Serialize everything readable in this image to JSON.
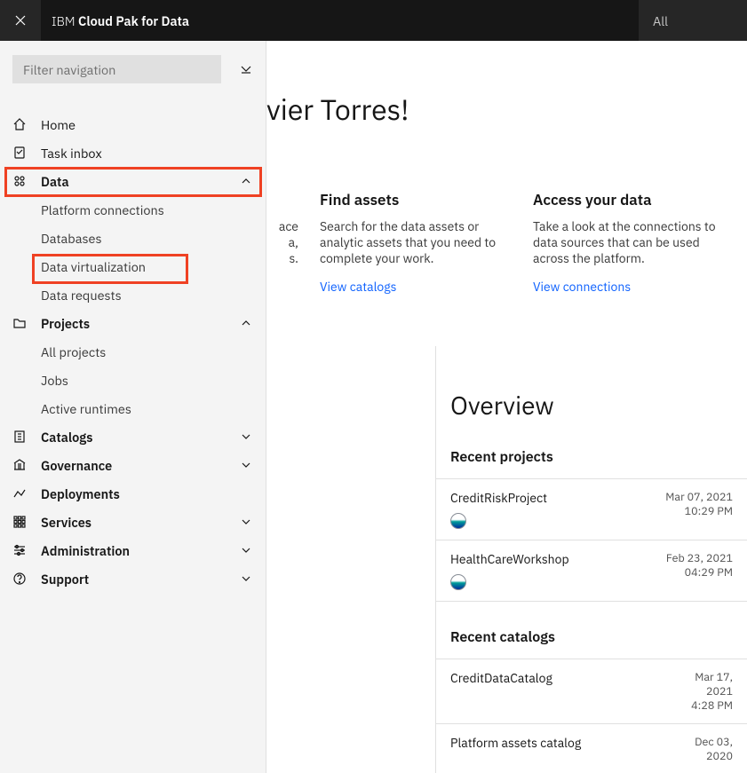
{
  "header": {
    "brand_prefix": "IBM ",
    "brand_product": "Cloud Pak for Data",
    "all_label": "All"
  },
  "sidebar": {
    "filter_placeholder": "Filter navigation",
    "items": {
      "home": "Home",
      "task_inbox": "Task inbox",
      "data": "Data",
      "data_children": {
        "platform_connections": "Platform connections",
        "databases": "Databases",
        "data_virtualization": "Data virtualization",
        "data_requests": "Data requests"
      },
      "projects": "Projects",
      "projects_children": {
        "all_projects": "All projects",
        "jobs": "Jobs",
        "active_runtimes": "Active runtimes"
      },
      "catalogs": "Catalogs",
      "governance": "Governance",
      "deployments": "Deployments",
      "services": "Services",
      "administration": "Administration",
      "support": "Support"
    }
  },
  "main": {
    "greeting_partial": "vier Torres!",
    "cards": {
      "work": {
        "title_partial": "",
        "desc": "ace ta, s.",
        "desc_l1": "ace",
        "desc_l2": "a,",
        "desc_l3": "s."
      },
      "find": {
        "title": "Find assets",
        "desc": "Search for the data assets or analytic assets that you need to complete your work.",
        "link": "View catalogs"
      },
      "access": {
        "title": "Access your data",
        "desc": "Take a look at the connections to data sources that can be used across the platform.",
        "link": "View connections"
      }
    },
    "overview": {
      "title": "Overview",
      "recent_projects_header": "Recent projects",
      "projects": [
        {
          "name": "CreditRiskProject",
          "date": "Mar 07, 2021",
          "time": "10:29 PM"
        },
        {
          "name": "HealthCareWorkshop",
          "date": "Feb 23, 2021",
          "time": "04:29 PM"
        }
      ],
      "recent_catalogs_header": "Recent catalogs",
      "catalogs": [
        {
          "name": "CreditDataCatalog",
          "date": "Mar 17, 2021",
          "time": "4:28 PM"
        },
        {
          "name": "Platform assets catalog",
          "date": "Dec 03, 2020",
          "time": ""
        }
      ]
    }
  }
}
